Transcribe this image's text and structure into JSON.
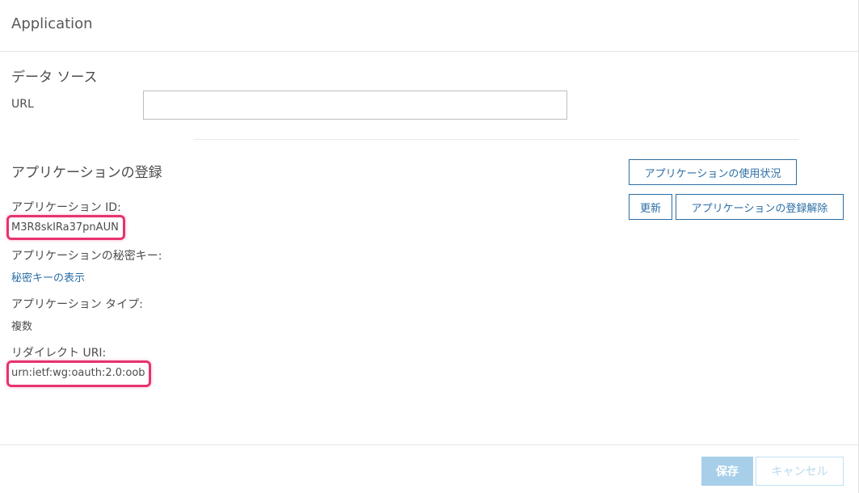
{
  "header": {
    "title": "Application"
  },
  "data_source": {
    "section_title": "データ ソース",
    "url_label": "URL",
    "url_value": ""
  },
  "registration": {
    "section_title": "アプリケーションの登録",
    "app_id_label": "アプリケーション ID:",
    "app_id_value": "M3R8skIRa37pnAUN",
    "secret_label": "アプリケーションの秘密キー:",
    "secret_link": "秘密キーの表示",
    "type_label": "アプリケーション タイプ:",
    "type_value": "複数",
    "redirect_label": "リダイレクト URI:",
    "redirect_value": "urn:ietf:wg:oauth:2.0:oob"
  },
  "actions": {
    "usage_button": "アプリケーションの使用状況",
    "refresh_button": "更新",
    "unregister_button": "アプリケーションの登録解除"
  },
  "footer": {
    "save_button": "保存",
    "cancel_button": "キャンセル"
  },
  "colors": {
    "accent": "#2b6ea5",
    "highlight": "#e6336e",
    "save_disabled": "#a8cfe9"
  }
}
